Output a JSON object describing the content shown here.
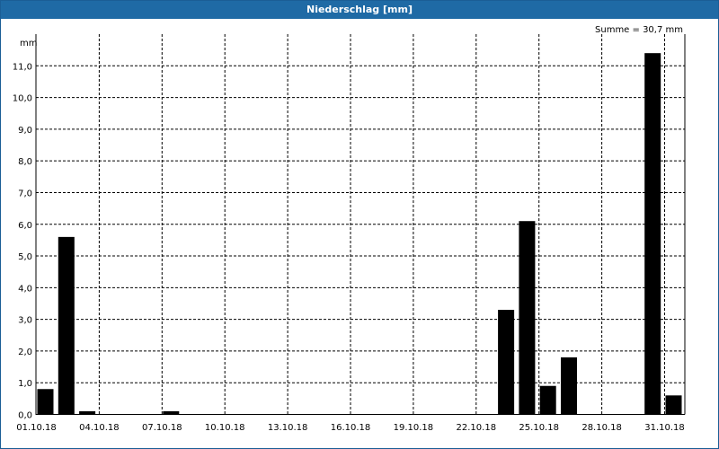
{
  "chart_data": {
    "type": "bar",
    "title": "Niederschlag [mm]",
    "ylabel": "mm",
    "annotation": "Summe = 30,7 mm",
    "ylim": [
      0,
      12
    ],
    "grid": true,
    "yticks": [
      "0,0",
      "1,0",
      "2,0",
      "3,0",
      "4,0",
      "5,0",
      "6,0",
      "7,0",
      "8,0",
      "9,0",
      "10,0",
      "11,0"
    ],
    "xticks": [
      "01.10.18",
      "04.10.18",
      "07.10.18",
      "10.10.18",
      "13.10.18",
      "16.10.18",
      "19.10.18",
      "22.10.18",
      "25.10.18",
      "28.10.18",
      "31.10.18"
    ],
    "categories": [
      "01.10.18",
      "02.10.18",
      "03.10.18",
      "04.10.18",
      "05.10.18",
      "06.10.18",
      "07.10.18",
      "08.10.18",
      "09.10.18",
      "10.10.18",
      "11.10.18",
      "12.10.18",
      "13.10.18",
      "14.10.18",
      "15.10.18",
      "16.10.18",
      "17.10.18",
      "18.10.18",
      "19.10.18",
      "20.10.18",
      "21.10.18",
      "22.10.18",
      "23.10.18",
      "24.10.18",
      "25.10.18",
      "26.10.18",
      "27.10.18",
      "28.10.18",
      "29.10.18",
      "30.10.18",
      "31.10.18",
      "01.11.18"
    ],
    "values": [
      0.8,
      5.6,
      0.1,
      0,
      0,
      0,
      0.1,
      0,
      0,
      0,
      0,
      0,
      0,
      0,
      0,
      0,
      0,
      0,
      0,
      0,
      0,
      0,
      3.3,
      6.1,
      0.9,
      1.8,
      0,
      0,
      0,
      11.4,
      0.6,
      0
    ]
  }
}
